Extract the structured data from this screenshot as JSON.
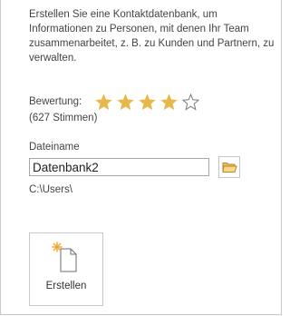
{
  "template": {
    "description": "Erstellen Sie eine Kontaktdatenbank, um Informationen zu Personen, mit denen Ihr Team zusammenarbeitet, z. B. zu Kunden und Partnern, zu verwalten."
  },
  "rating": {
    "label": "Bewertung:",
    "value": 4,
    "max": 5,
    "votes_text": "(627 Stimmen)",
    "filled_color": "#e8b84a",
    "empty_color": "#7a7a7a"
  },
  "file": {
    "label": "Dateiname",
    "value": "Datenbank2",
    "path": "C:\\Users\\",
    "browse_icon": "folder-icon"
  },
  "actions": {
    "create_label": "Erstellen",
    "create_icon": "new-document-icon"
  }
}
